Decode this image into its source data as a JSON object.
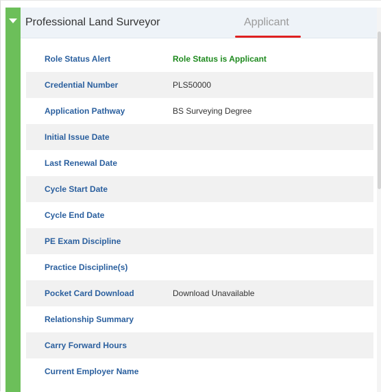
{
  "header": {
    "title": "Professional Land Surveyor",
    "status": "Applicant"
  },
  "rows": [
    {
      "label": "Role Status Alert",
      "value": "Role Status is Applicant"
    },
    {
      "label": "Credential Number",
      "value": "PLS50000"
    },
    {
      "label": "Application Pathway",
      "value": "BS Surveying Degree"
    },
    {
      "label": "Initial Issue Date",
      "value": ""
    },
    {
      "label": "Last Renewal Date",
      "value": ""
    },
    {
      "label": "Cycle Start Date",
      "value": ""
    },
    {
      "label": "Cycle End Date",
      "value": ""
    },
    {
      "label": "PE Exam Discipline",
      "value": ""
    },
    {
      "label": "Practice Discipline(s)",
      "value": ""
    },
    {
      "label": "Pocket Card Download",
      "value": "Download Unavailable"
    },
    {
      "label": "Relationship Summary",
      "value": ""
    },
    {
      "label": "Carry Forward Hours",
      "value": ""
    },
    {
      "label": "Current Employer Name",
      "value": ""
    }
  ],
  "colors": {
    "accent_green": "#6cbf5a",
    "label_blue": "#2a5f9e",
    "alert_green": "#1e8a1e",
    "underline_red": "#e02020"
  },
  "icons": {
    "toggle": "caret-down-icon"
  }
}
